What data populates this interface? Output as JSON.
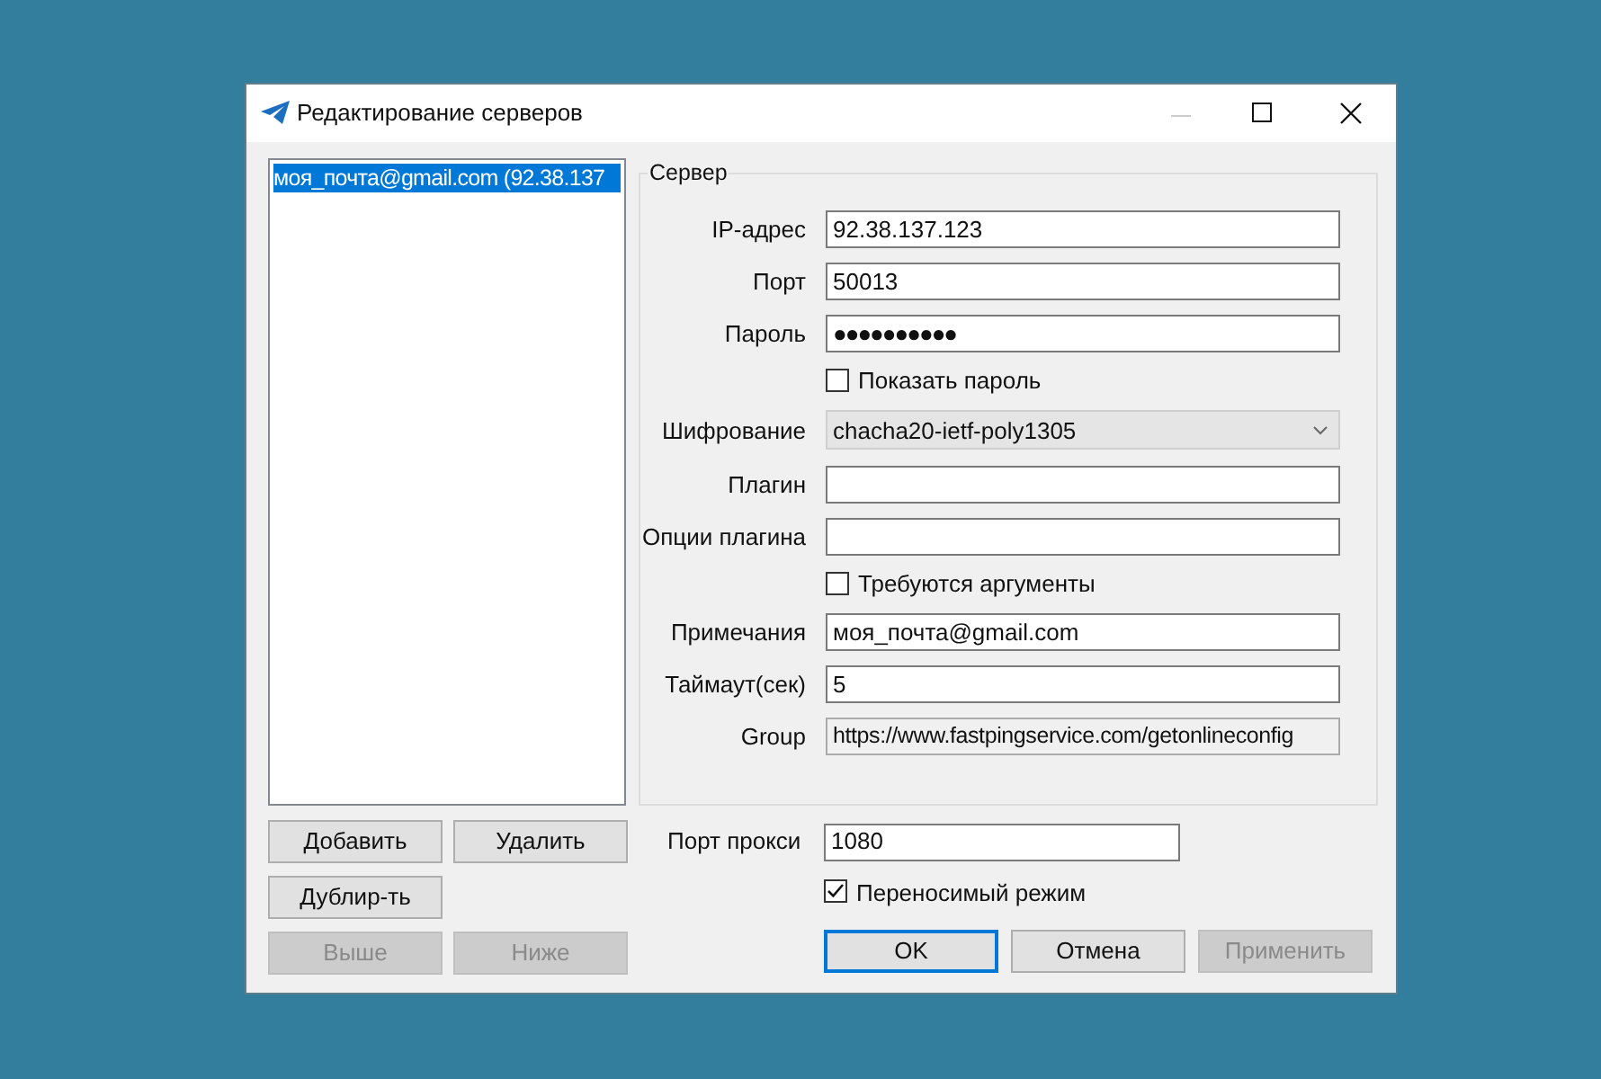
{
  "window": {
    "title": "Редактирование серверов"
  },
  "servers": [
    {
      "label": "моя_почта@gmail.com (92.38.137",
      "selected": true
    }
  ],
  "server_group": {
    "title": "Сервер",
    "fields": [
      {
        "kind": "text",
        "label": "IP-адрес",
        "value": "92.38.137.123"
      },
      {
        "kind": "text",
        "label": "Порт",
        "value": "50013"
      },
      {
        "kind": "password",
        "label": "Пароль",
        "value": "●●●●●●●●●●"
      },
      {
        "kind": "checkbox",
        "label": "Показать пароль",
        "checked": false
      },
      {
        "kind": "combo",
        "label": "Шифрование",
        "value": "chacha20-ietf-poly1305"
      },
      {
        "kind": "text",
        "label": "Плагин"
      },
      {
        "kind": "text",
        "label": "Опции плагина"
      },
      {
        "kind": "checkbox",
        "label": "Требуются аргументы",
        "checked": false
      },
      {
        "kind": "text",
        "label": "Примечания",
        "value": "моя_почта@gmail.com"
      },
      {
        "kind": "text",
        "label": "Таймаут(сек)",
        "value": "5"
      },
      {
        "kind": "readonly",
        "label": "Group",
        "value": "https://www.fastpingservice.com/getonlineconfig"
      }
    ]
  },
  "list_buttons": [
    {
      "label": "Добавить",
      "disabled": false
    },
    {
      "label": "Удалить",
      "disabled": false
    },
    {
      "label": "Дублир-ть",
      "disabled": false
    },
    {
      "label": "Выше",
      "disabled": true
    },
    {
      "label": "Ниже",
      "disabled": true
    }
  ],
  "proxy_port": {
    "label": "Порт прокси",
    "value": "1080"
  },
  "portable_mode": {
    "label": "Переносимый режим",
    "checked": true
  },
  "dialog_buttons": [
    {
      "label": "OK",
      "default": true,
      "disabled": false
    },
    {
      "label": "Отмена",
      "default": false,
      "disabled": false
    },
    {
      "label": "Применить",
      "default": false,
      "disabled": true
    }
  ]
}
